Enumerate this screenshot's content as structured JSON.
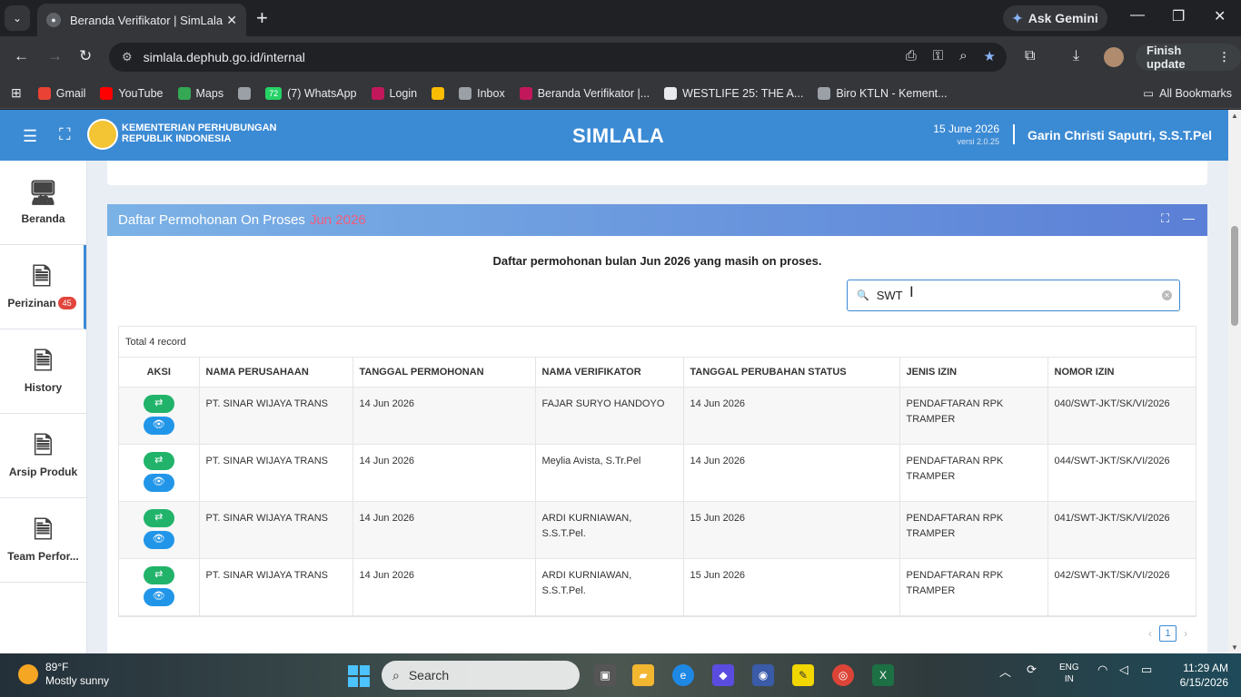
{
  "browser": {
    "tab_title": "Beranda Verifikator | SimLala",
    "new_tab": "+",
    "gemini_label": "Ask Gemini",
    "url": "simlala.dephub.go.id/internal",
    "finish_update": "Finish update",
    "bookmarks": [
      {
        "label": "Gmail",
        "icon": "gmail-icon",
        "color": "#ea4335"
      },
      {
        "label": "YouTube",
        "icon": "youtube-icon",
        "color": "#ff0000"
      },
      {
        "label": "Maps",
        "icon": "maps-icon",
        "color": "#34a853"
      },
      {
        "label": "",
        "icon": "globe-icon",
        "color": "#9aa0a6"
      },
      {
        "label": "(7) WhatsApp",
        "icon": "whatsapp-icon",
        "color": "#25d366",
        "count": "72"
      },
      {
        "label": "Login",
        "icon": "login-icon",
        "color": "#c2185b"
      },
      {
        "label": "",
        "icon": "pinwheel-icon",
        "color": "#fbbc04"
      },
      {
        "label": "Inbox",
        "icon": "mail-icon",
        "color": "#9aa0a6"
      },
      {
        "label": "Beranda Verifikator |...",
        "icon": "simlala-icon",
        "color": "#c2185b"
      },
      {
        "label": "WESTLIFE 25: THE A...",
        "icon": "page-icon",
        "color": "#e8eaed"
      },
      {
        "label": "Biro KTLN - Kement...",
        "icon": "globe-icon",
        "color": "#9aa0a6"
      }
    ],
    "all_bookmarks": "All Bookmarks"
  },
  "app": {
    "ministry_line1": "KEMENTERIAN PERHUBUNGAN",
    "ministry_line2": "REPUBLIK INDONESIA",
    "title": "SIMLALA",
    "date": "15 June 2026",
    "version": "versi 2.0.25",
    "user": "Garin Christi Saputri, S.S.T.Pel"
  },
  "sidebar": {
    "items": [
      {
        "label": "Beranda",
        "icon": "monitor-icon"
      },
      {
        "label": "Perizinan",
        "icon": "document-icon",
        "badge": "45"
      },
      {
        "label": "History",
        "icon": "document-icon"
      },
      {
        "label": "Arsip Produk",
        "icon": "document-icon"
      },
      {
        "label": "Team Perfor...",
        "icon": "document-icon"
      }
    ]
  },
  "panel": {
    "title": "Daftar Permohonan On Proses",
    "month": "Jun 2026",
    "description": "Daftar permohonan bulan Jun 2026 yang masih on proses.",
    "search_value": "SWT",
    "total": "Total 4 record",
    "columns": [
      "AKSI",
      "NAMA PERUSAHAAN",
      "TANGGAL PERMOHONAN",
      "NAMA VERIFIKATOR",
      "TANGGAL PERUBAHAN STATUS",
      "JENIS IZIN",
      "NOMOR IZIN"
    ],
    "rows": [
      {
        "perusahaan": "PT. SINAR WIJAYA TRANS",
        "tgl_permohonan": "14 Jun 2026",
        "verifikator": "FAJAR SURYO HANDOYO",
        "tgl_status": "14 Jun 2026",
        "jenis_izin": "PENDAFTARAN RPK TRAMPER",
        "nomor_izin": "040/SWT-JKT/SK/VI/2026"
      },
      {
        "perusahaan": "PT. SINAR WIJAYA TRANS",
        "tgl_permohonan": "14 Jun 2026",
        "verifikator": "Meylia Avista, S.Tr.Pel",
        "tgl_status": "14 Jun 2026",
        "jenis_izin": "PENDAFTARAN RPK TRAMPER",
        "nomor_izin": "044/SWT-JKT/SK/VI/2026"
      },
      {
        "perusahaan": "PT. SINAR WIJAYA TRANS",
        "tgl_permohonan": "14 Jun 2026",
        "verifikator": "ARDI KURNIAWAN, S.S.T.Pel.",
        "tgl_status": "15 Jun 2026",
        "jenis_izin": "PENDAFTARAN RPK TRAMPER",
        "nomor_izin": "041/SWT-JKT/SK/VI/2026"
      },
      {
        "perusahaan": "PT. SINAR WIJAYA TRANS",
        "tgl_permohonan": "14 Jun 2026",
        "verifikator": "ARDI KURNIAWAN, S.S.T.Pel.",
        "tgl_status": "15 Jun 2026",
        "jenis_izin": "PENDAFTARAN RPK TRAMPER",
        "nomor_izin": "042/SWT-JKT/SK/VI/2026"
      }
    ],
    "page": "1"
  },
  "taskbar": {
    "temp": "89°F",
    "weather": "Mostly sunny",
    "search": "Search",
    "lang1": "ENG",
    "lang2": "IN",
    "time": "11:29 AM",
    "date": "6/15/2026"
  }
}
